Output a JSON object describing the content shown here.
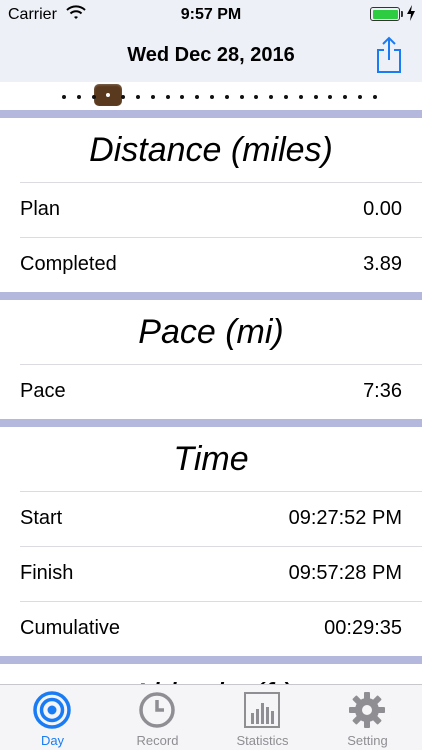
{
  "status_bar": {
    "carrier": "Carrier",
    "time": "9:57 PM"
  },
  "nav": {
    "title": "Wed Dec 28, 2016"
  },
  "pager": {
    "page_count": 22,
    "active_index": 3
  },
  "sections": {
    "distance": {
      "title": "Distance (miles)",
      "rows": [
        {
          "label": "Plan",
          "value": "0.00"
        },
        {
          "label": "Completed",
          "value": "3.89"
        }
      ]
    },
    "pace": {
      "title": "Pace (mi)",
      "rows": [
        {
          "label": "Pace",
          "value": "7:36"
        }
      ]
    },
    "time": {
      "title": "Time",
      "rows": [
        {
          "label": "Start",
          "value": "09:27:52 PM"
        },
        {
          "label": "Finish",
          "value": "09:57:28 PM"
        },
        {
          "label": "Cumulative",
          "value": "00:29:35"
        }
      ]
    },
    "altitude": {
      "title": "Altitude (ft)"
    }
  },
  "tabs": [
    {
      "label": "Day",
      "icon": "target-icon",
      "active": true
    },
    {
      "label": "Record",
      "icon": "clock-icon",
      "active": false
    },
    {
      "label": "Statistics",
      "icon": "bar-chart-icon",
      "active": false
    },
    {
      "label": "Setting",
      "icon": "gear-icon",
      "active": false
    }
  ],
  "colors": {
    "accent": "#1a7cf5",
    "section_divider": "#b4b8dd",
    "bar_background": "#eef0f7",
    "battery": "#2ecc40",
    "pager_active": "#5a3a1e",
    "tab_inactive": "#8e8e93"
  }
}
